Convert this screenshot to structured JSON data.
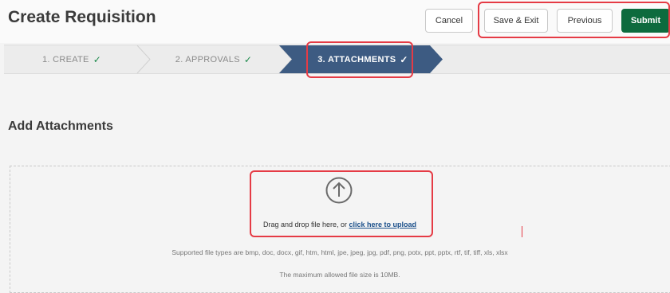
{
  "header": {
    "title": "Create Requisition",
    "buttons": {
      "cancel": "Cancel",
      "save_exit": "Save & Exit",
      "previous": "Previous",
      "submit": "Submit"
    }
  },
  "steps": [
    {
      "label": "1. CREATE",
      "status": "complete"
    },
    {
      "label": "2. APPROVALS",
      "status": "complete"
    },
    {
      "label": "3. ATTACHMENTS",
      "status": "active"
    }
  ],
  "attachments": {
    "section_title": "Add Attachments",
    "drag_text": "Drag and drop file here, or ",
    "upload_link": "click here to upload",
    "supported_types": "Supported file types are bmp, doc, docx, gif, htm, html, jpe, jpeg, jpg, pdf, png, potx, ppt, pptx, rtf, tif, tiff, xls, xlsx",
    "max_size": "The maximum allowed file size is 10MB."
  },
  "icons": {
    "check": "check-icon",
    "upload": "upload-arrow-icon"
  },
  "colors": {
    "primary": "#0d6b3e",
    "active_step": "#3d5b82",
    "highlight": "#e53b45",
    "link": "#1a4f8a"
  }
}
